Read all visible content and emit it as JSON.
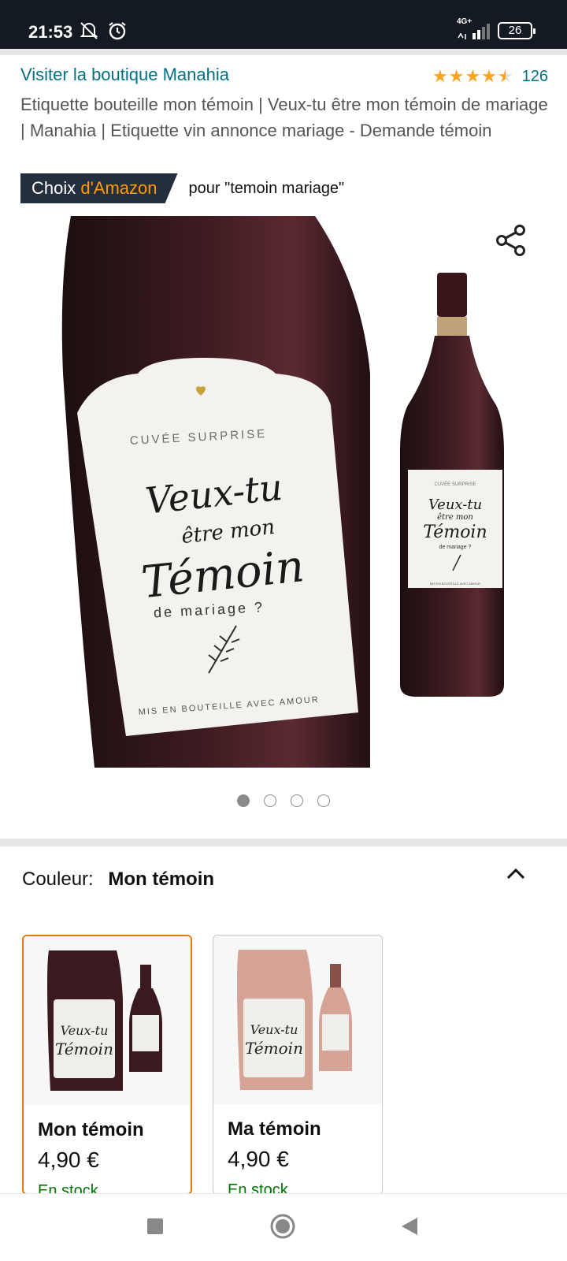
{
  "status_bar": {
    "time": "21:53",
    "network": "4G+",
    "battery": "26",
    "icons": [
      "silent-icon",
      "alarm-icon",
      "signal-icon",
      "battery-icon"
    ]
  },
  "product": {
    "store_link": "Visiter la boutique Manahia",
    "rating": 4.5,
    "rating_count": "126",
    "title": "Etiquette bouteille mon témoin | Veux-tu être mon témoin de mariage | Manahia | Etiquette vin annonce mariage - Demande témoin",
    "badge": {
      "part1": "Choix",
      "part2": "d'Amazon",
      "suffix": "pour \"temoin mariage\""
    }
  },
  "gallery": {
    "label_line1": "CUVÉE SURPRISE",
    "label_line2": "Veux-tu",
    "label_line3": "être mon",
    "label_line4": "Témoin",
    "label_line5": "de mariage ?",
    "label_line6": "MIS EN BOUTEILLE AVEC AMOUR",
    "page_count": 4,
    "active_page": 1
  },
  "variants": {
    "label": "Couleur:",
    "selected": "Mon témoin",
    "options": [
      {
        "name": "Mon témoin",
        "price": "4,90 €",
        "extra": "En stock",
        "bottle_color": "#3a1a1e"
      },
      {
        "name": "Ma témoin",
        "price": "4,90 €",
        "extra": "En stock",
        "bottle_color": "#d6a397"
      }
    ]
  },
  "colors": {
    "link": "#007185",
    "star": "#ffa41c",
    "badge_bg": "#232f3e",
    "badge_accent": "#ff9900",
    "selected_border": "#e47911"
  }
}
